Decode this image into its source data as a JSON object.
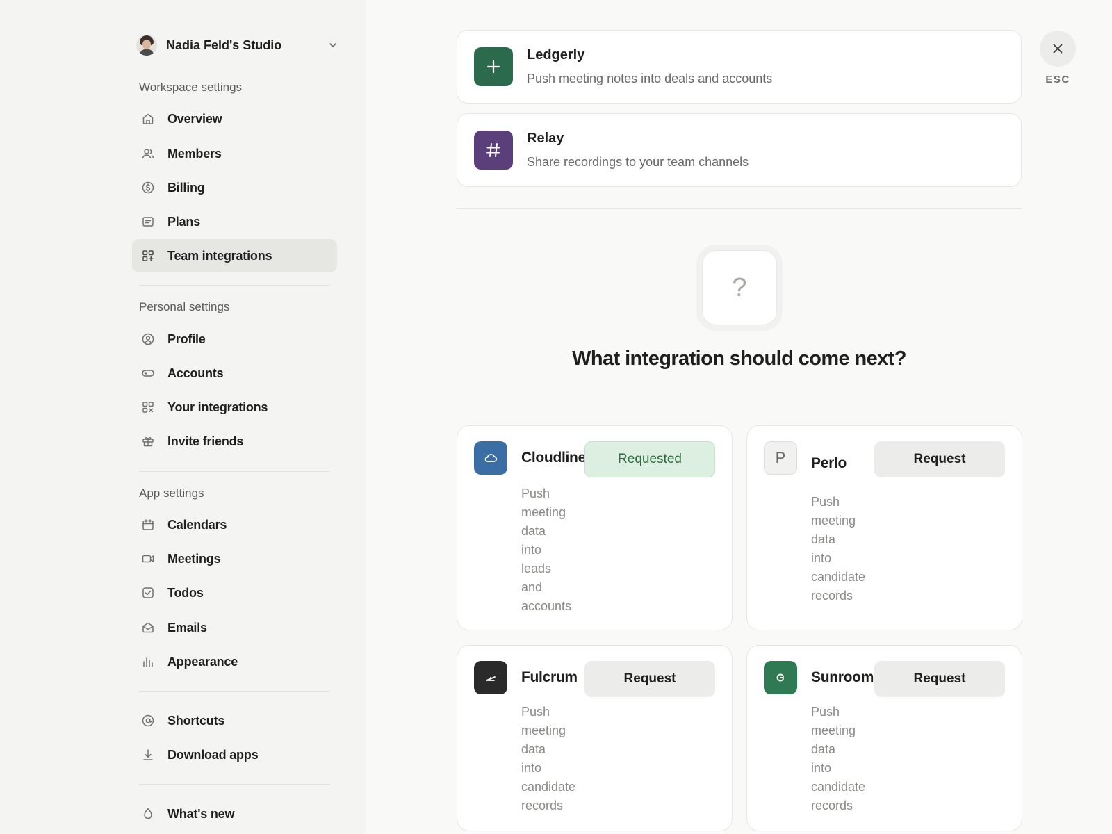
{
  "workspace": {
    "name": "Nadia Feld's Studio"
  },
  "sidebar": {
    "workspace_label": "Workspace settings",
    "workspace_items": [
      {
        "label": "Overview",
        "icon": "home-icon"
      },
      {
        "label": "Members",
        "icon": "users-icon"
      },
      {
        "label": "Billing",
        "icon": "dollar-icon"
      },
      {
        "label": "Plans",
        "icon": "document-icon"
      },
      {
        "label": "Team integrations",
        "icon": "grid-plus-icon",
        "active": true
      }
    ],
    "personal_label": "Personal settings",
    "personal_items": [
      {
        "label": "Profile",
        "icon": "user-circle-icon"
      },
      {
        "label": "Accounts",
        "icon": "toggle-icon"
      },
      {
        "label": "Your integrations",
        "icon": "grid-x-icon"
      },
      {
        "label": "Invite friends",
        "icon": "gift-icon"
      }
    ],
    "app_label": "App settings",
    "app_items": [
      {
        "label": "Calendars",
        "icon": "calendar-icon"
      },
      {
        "label": "Meetings",
        "icon": "video-icon"
      },
      {
        "label": "Todos",
        "icon": "checkbox-icon"
      },
      {
        "label": "Emails",
        "icon": "envelope-icon"
      },
      {
        "label": "Appearance",
        "icon": "bars-icon"
      }
    ],
    "misc_items": [
      {
        "label": "Shortcuts",
        "icon": "at-icon"
      },
      {
        "label": "Download apps",
        "icon": "download-icon"
      }
    ],
    "footer_items": [
      {
        "label": "What's new",
        "icon": "drop-icon"
      }
    ]
  },
  "integrations": [
    {
      "name": "Ledgerly",
      "description": "Push meeting notes into deals and accounts",
      "color": "#2c6a4d",
      "icon": "plus-icon"
    },
    {
      "name": "Relay",
      "description": "Share recordings to your team channels",
      "color": "#5a3f7a",
      "icon": "hash-icon"
    }
  ],
  "suggest": {
    "icon_text": "?",
    "headline": "What integration should come next?"
  },
  "requests": [
    {
      "name": "Cloudline",
      "description": "Push meeting data into leads and accounts",
      "button": "Requested",
      "state": "requested",
      "color": "#3b6ea5",
      "icon": "cloud-icon"
    },
    {
      "name": "Perlo",
      "description": "Push meeting data into candidate records",
      "button": "Request",
      "state": "default",
      "color": "#f1f1ef",
      "icon_text": "P"
    },
    {
      "name": "Fulcrum",
      "description": "Push meeting data into candidate records",
      "button": "Request",
      "state": "default",
      "color": "#2a2a2a",
      "icon": "lever-icon"
    },
    {
      "name": "Sunroom",
      "description": "Push meeting data into candidate records",
      "button": "Request",
      "state": "default",
      "color": "#2f7a52",
      "icon": "swirl-icon"
    }
  ],
  "close": {
    "label": "ESC"
  }
}
